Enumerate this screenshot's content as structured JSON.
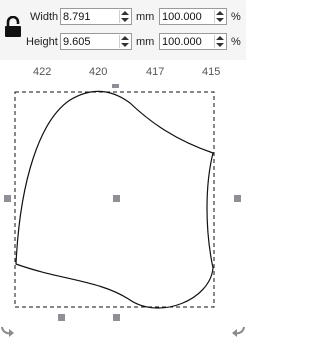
{
  "dimensions": {
    "lock_icon": "lock-icon",
    "width": {
      "label": "Width",
      "value": "8.791",
      "unit": "mm",
      "percent": "100.000",
      "percent_unit": "%"
    },
    "height": {
      "label": "Height",
      "value": "9.605",
      "unit": "mm",
      "percent": "100.000",
      "percent_unit": "%"
    }
  },
  "ruler": {
    "ticks": [
      "422",
      "420",
      "417",
      "415"
    ]
  },
  "canvas": {
    "handle_icons": [
      "rotate-handle-icon",
      "scale-handle-icon"
    ],
    "selection_style": "dashed"
  }
}
